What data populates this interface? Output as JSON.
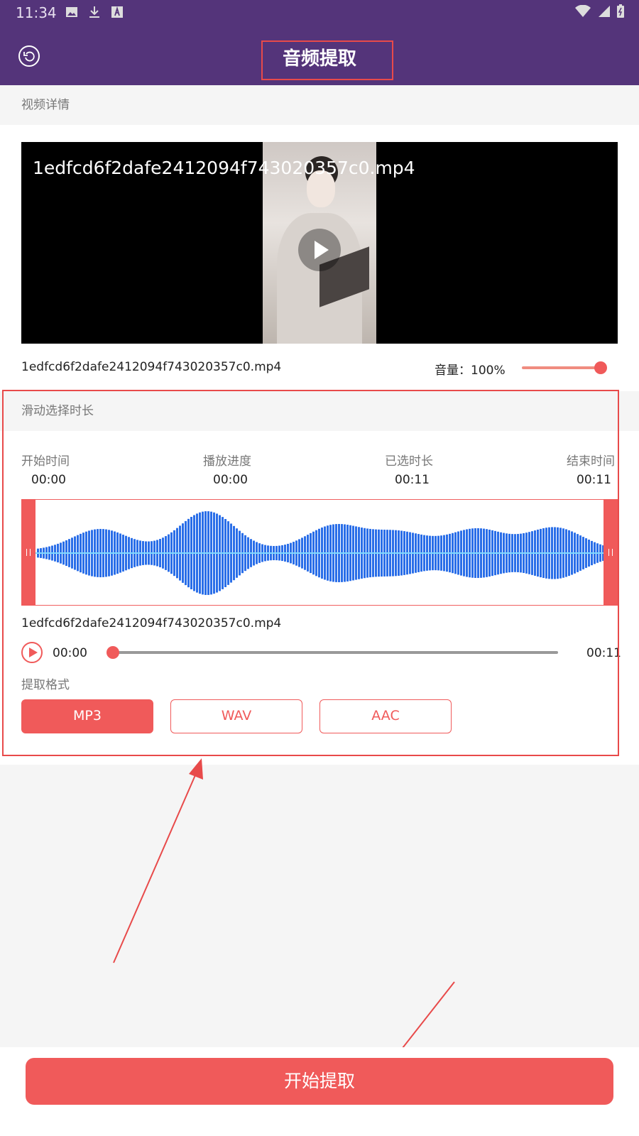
{
  "status_bar": {
    "time": "11:34"
  },
  "header": {
    "title": "音频提取"
  },
  "video_section": {
    "heading": "视频详情",
    "file_name": "1edfcd6f2dafe2412094f743020357c0.mp4",
    "volume_label": "音量：100%",
    "volume": 1.0
  },
  "trim_section": {
    "heading": "滑动选择时长",
    "columns": [
      {
        "label": "开始时间",
        "value": "00:00"
      },
      {
        "label": "播放进度",
        "value": "00:00"
      },
      {
        "label": "已选时长",
        "value": "00:11"
      },
      {
        "label": "结束时间",
        "value": "00:11"
      }
    ],
    "file_name": "1edfcd6f2dafe2412094f743020357c0.mp4",
    "current_time": "00:00",
    "total_time": "00:11",
    "progress": 0.0,
    "format_label": "提取格式",
    "formats": [
      {
        "label": "MP3",
        "selected": true
      },
      {
        "label": "WAV",
        "selected": false
      },
      {
        "label": "AAC",
        "selected": false
      }
    ]
  },
  "start_button": {
    "label": "开始提取"
  },
  "colors": {
    "header": "#54347a",
    "accent": "#f05a5a",
    "annotation": "#e84a4a"
  }
}
